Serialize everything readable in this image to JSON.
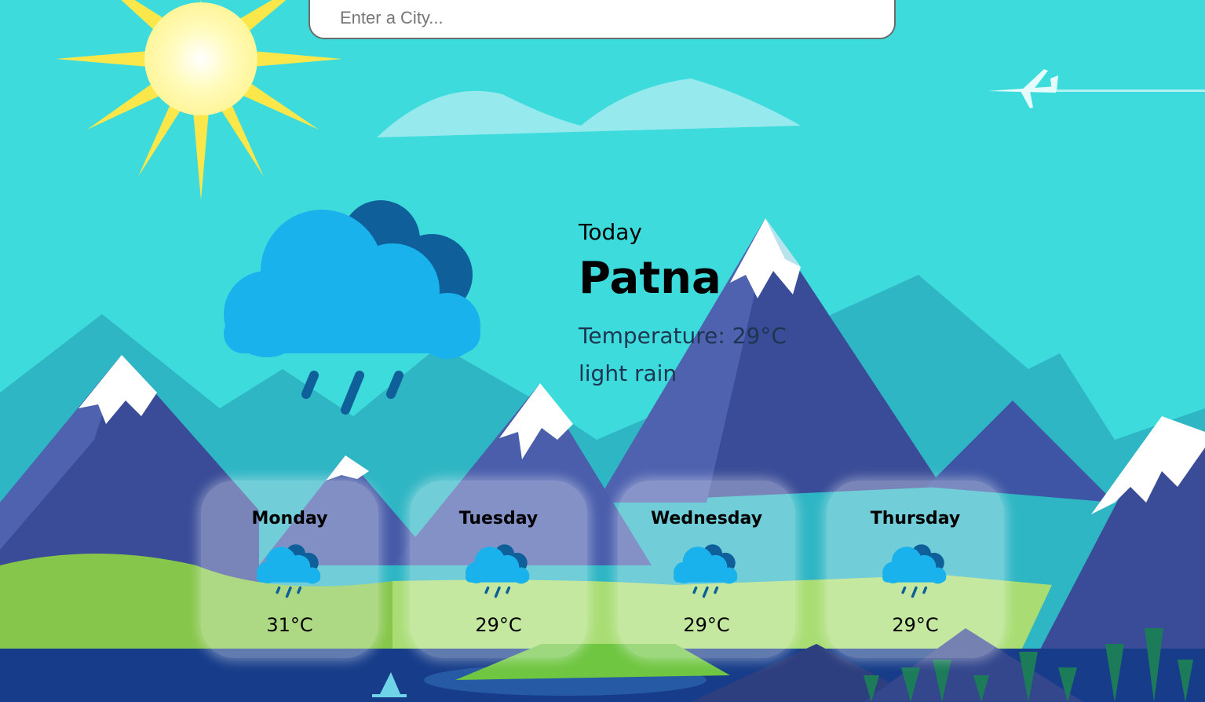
{
  "search": {
    "placeholder": "Enter a City..."
  },
  "current": {
    "label": "Today",
    "city": "Patna",
    "temperature": "Temperature: 29°C",
    "description": "light rain",
    "icon": "rain-cloud-icon"
  },
  "forecast": [
    {
      "day": "Monday",
      "temp": "31°C",
      "icon": "rain-cloud-icon"
    },
    {
      "day": "Tuesday",
      "temp": "29°C",
      "icon": "rain-cloud-icon"
    },
    {
      "day": "Wednesday",
      "temp": "29°C",
      "icon": "rain-cloud-icon"
    },
    {
      "day": "Thursday",
      "temp": "29°C",
      "icon": "rain-cloud-icon"
    }
  ],
  "colors": {
    "sky": "#3ddbdc",
    "cloud_front": "#19b2ec",
    "cloud_back": "#0e5f9a",
    "rain": "#0e5f9a"
  }
}
